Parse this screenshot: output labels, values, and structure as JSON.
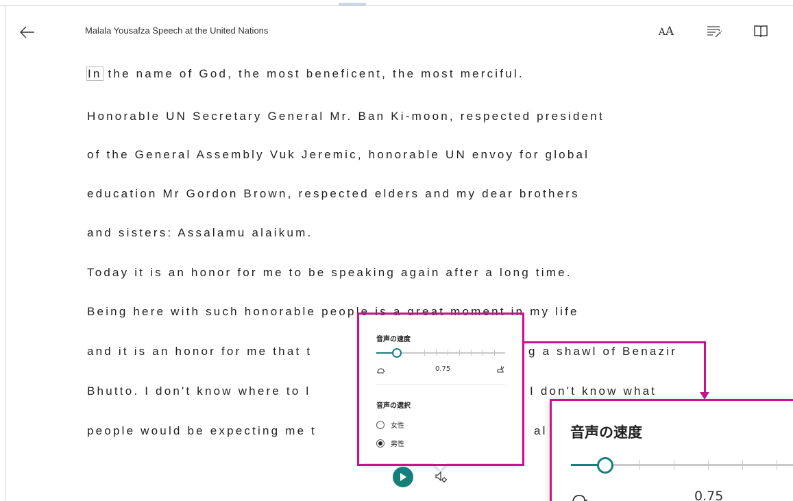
{
  "header": {
    "doc_title": "Malala Yousafza Speech at the United Nations",
    "text_size_small": "A",
    "text_size_big": "A"
  },
  "reading": {
    "first_word": "In",
    "lines": [
      " the name of God, the most beneficent, the most merciful.",
      "Honorable UN Secretary General Mr. Ban Ki-moon, respected president",
      "of the General Assembly Vuk Jeremic, honorable UN envoy for global",
      "education Mr Gordon Brown, respected elders and my dear brothers",
      "and sisters: Assalamu alaikum.",
      "Today it is an honor for me to be speaking again after a long time.",
      "Being here with such honorable people is a great moment in my life",
      "and it is an honor for me that t",
      "Bhutto. I don't know where to l",
      "people would be expecting me t"
    ],
    "partial_right": [
      "g a shawl of Benazir",
      "I don't know what",
      "al"
    ]
  },
  "voice_popup": {
    "speed_heading": "音声の速度",
    "speed_value": "0.75",
    "speed_fraction": 0.12,
    "tick_count": 7,
    "voice_heading": "音声の選択",
    "options": [
      {
        "label": "女性",
        "selected": false
      },
      {
        "label": "男性",
        "selected": true
      }
    ]
  },
  "zoom_callout": {
    "speed_heading": "音声の速度",
    "speed_value": "0.75"
  },
  "colors": {
    "accent": "#167f7a",
    "highlight": "#c8128c"
  }
}
